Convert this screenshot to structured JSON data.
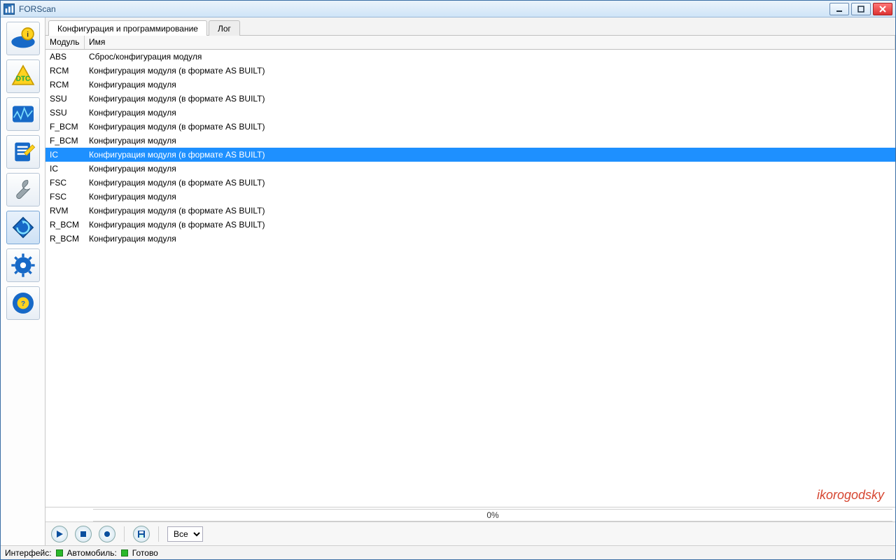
{
  "window": {
    "title": "FORScan"
  },
  "tabs": {
    "config_label": "Конфигурация и программирование",
    "log_label": "Лог"
  },
  "columns": {
    "module": "Модуль",
    "name": "Имя"
  },
  "rows": [
    {
      "module": "ABS",
      "name": "Сброс/конфигурация модуля",
      "selected": false
    },
    {
      "module": "RCM",
      "name": "Конфигурация модуля (в формате AS BUILT)",
      "selected": false
    },
    {
      "module": "RCM",
      "name": "Конфигурация модуля",
      "selected": false
    },
    {
      "module": "SSU",
      "name": "Конфигурация модуля (в формате AS BUILT)",
      "selected": false
    },
    {
      "module": "SSU",
      "name": "Конфигурация модуля",
      "selected": false
    },
    {
      "module": "F_BCM",
      "name": "Конфигурация модуля (в формате AS BUILT)",
      "selected": false
    },
    {
      "module": "F_BCM",
      "name": "Конфигурация модуля",
      "selected": false
    },
    {
      "module": "IC",
      "name": "Конфигурация модуля (в формате AS BUILT)",
      "selected": true
    },
    {
      "module": "IC",
      "name": "Конфигурация модуля",
      "selected": false
    },
    {
      "module": "FSC",
      "name": "Конфигурация модуля (в формате AS BUILT)",
      "selected": false
    },
    {
      "module": "FSC",
      "name": "Конфигурация модуля",
      "selected": false
    },
    {
      "module": "RVM",
      "name": "Конфигурация модуля (в формате AS BUILT)",
      "selected": false
    },
    {
      "module": "R_BCM",
      "name": "Конфигурация модуля (в формате AS BUILT)",
      "selected": false
    },
    {
      "module": "R_BCM",
      "name": "Конфигурация модуля",
      "selected": false
    }
  ],
  "progress": {
    "text": "0%"
  },
  "toolbar": {
    "filter_selected": "Все",
    "filter_options": [
      "Все"
    ]
  },
  "status": {
    "interface_label": "Интерфейс:",
    "vehicle_label": "Автомобиль:",
    "ready_label": "Готово"
  },
  "watermark": "ikorogodsky"
}
